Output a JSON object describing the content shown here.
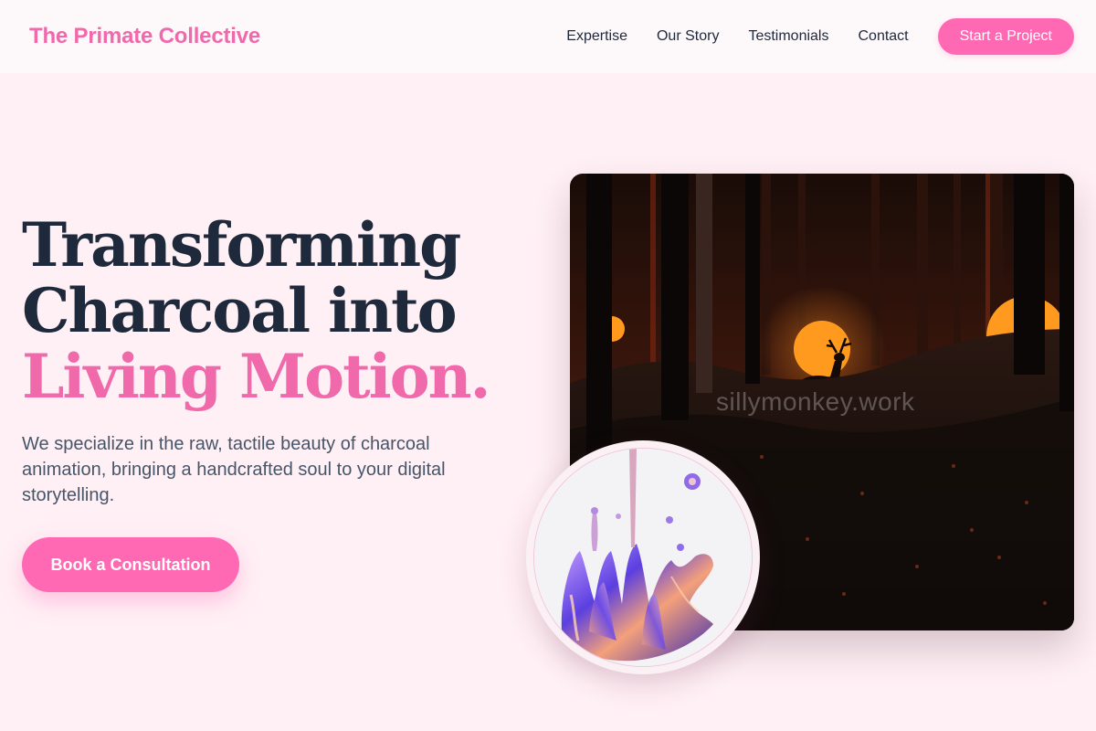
{
  "brand": {
    "name": "The Primate Collective",
    "accent_color": "#ff69b4"
  },
  "nav": {
    "items": [
      {
        "label": "Expertise"
      },
      {
        "label": "Our Story"
      },
      {
        "label": "Testimonials"
      },
      {
        "label": "Contact"
      }
    ],
    "cta_label": "Start a Project"
  },
  "hero": {
    "title_line1": "Transforming",
    "title_line2": "Charcoal into",
    "title_accent": "Living Motion.",
    "description": "We specialize in the raw, tactile beauty of charcoal animation, bringing a handcrafted soul to your digital storytelling.",
    "cta_label": "Book a Consultation"
  },
  "media": {
    "scene_watermark": "sillymonkey.work"
  }
}
